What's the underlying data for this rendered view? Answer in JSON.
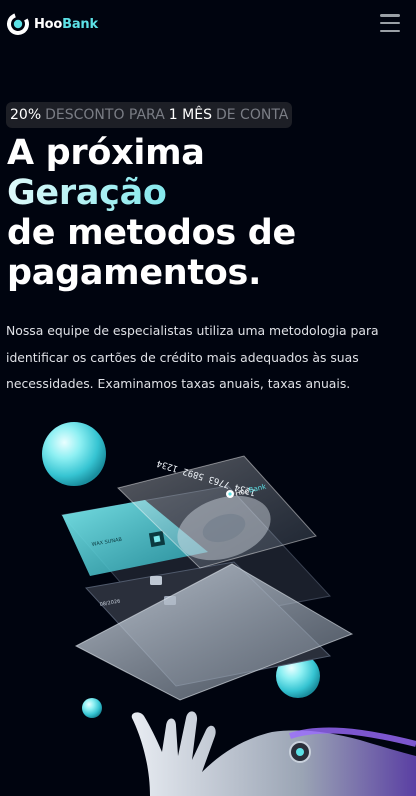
{
  "navbar": {
    "logo": {
      "part1": "Hoo",
      "part2": "Bank"
    },
    "menu_icon": "hamburger-menu-icon"
  },
  "hero": {
    "promo": {
      "percent": "20%",
      "text1": "DESCONTO PARA",
      "highlight": "1 MÊS",
      "text2": "DE CONTA"
    },
    "title": {
      "line1": "A próxima",
      "line2": "Geração",
      "line3": "de metodos de",
      "line4": "pagamentos."
    },
    "description": "Nossa equipe de especialistas utiliza uma metodologia para identificar os cartões de crédito mais adequados às suas necessidades. Examinamos taxas anuais, taxas anuais.",
    "card": {
      "number": "1234 7763 5892 1234",
      "expiry": "12/24",
      "brand_part1": "Hoo",
      "brand_part2": "Bank",
      "holder": "WAX SUNAB",
      "holder_sub": "08/2026"
    }
  },
  "colors": {
    "background": "#00040f",
    "accent": "#5ce1e6",
    "promo_bg": "#1d1f26",
    "muted_text": "#7a7d85"
  }
}
